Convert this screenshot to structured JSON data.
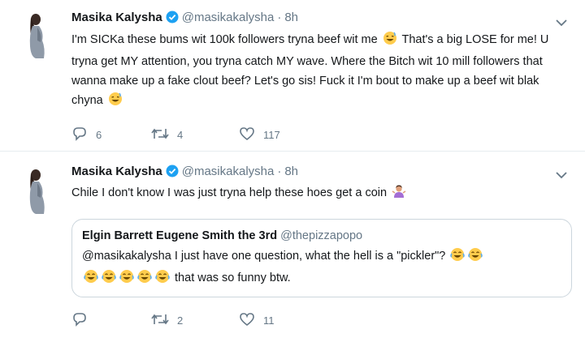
{
  "tweets": [
    {
      "name": "Masika Kalysha",
      "handle": "@masikakalysha",
      "dot": "·",
      "time": "8h",
      "text_parts": [
        "I'm SICKa these bums wit 100k followers tryna beef wit me",
        " That's a big LOSE for me! U tryna get MY attention, you tryna catch MY wave. Where the Bitch wit 10 mill followers that wanna make up a fake clout beef? Let's go sis! Fuck it I'm bout to make up a beef wit blak chyna"
      ],
      "emoji": "grinning-sweat-face",
      "replies": "6",
      "retweets": "4",
      "likes": "117"
    },
    {
      "name": "Masika Kalysha",
      "handle": "@masikakalysha",
      "dot": "·",
      "time": "8h",
      "text": "Chile I don't know I was just tryna help these hoes get a coin",
      "emoji": "person-shrugging",
      "quoted": {
        "name": "Elgin Barrett Eugene Smith the 3rd",
        "handle": "@thepizzapopo",
        "text_line1": "@masikakalysha I just have one question, what the hell is a \"pickler\"?",
        "text_line2": "that was so funny btw.",
        "emoji_count_line1": 2,
        "emoji_count_line2": 5,
        "emoji": "tears-of-joy"
      },
      "replies": "",
      "retweets": "2",
      "likes": "11"
    }
  ],
  "colors": {
    "text": "#14171a",
    "secondary": "#657786",
    "verified": "#1da1f2",
    "border": "#e6ecf0",
    "emoji": "#ffcc4d"
  }
}
